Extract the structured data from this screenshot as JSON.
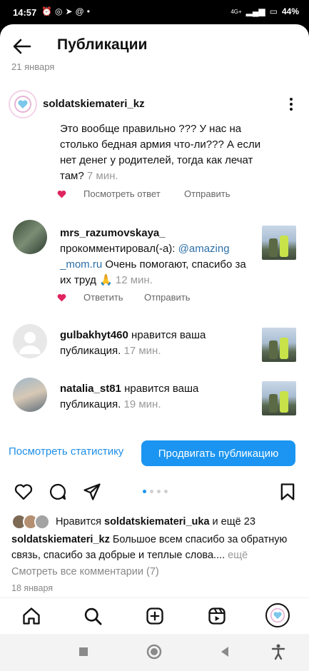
{
  "status": {
    "time": "14:57",
    "battery": "44%",
    "network": "4G+"
  },
  "header": {
    "title": "Публикации",
    "date_top": "21 января"
  },
  "comment1": {
    "username": "soldatskiemateri_kz",
    "text": "Это вообще правильно ??? У нас на столько бедная армия что-ли??? А если нет денег у родителей, тогда как лечат там?",
    "time": "7 мин.",
    "view_reply": "Посмотреть ответ",
    "send": "Отправить"
  },
  "comment2": {
    "username": "mrs_razumovskaya_",
    "verb": "прокомментировал(-а):",
    "mention_part1": "@amazing",
    "mention_part2": "_mom.ru",
    "text": "Очень помогают, спасибо за их труд 🙏",
    "time": "12 мин.",
    "reply": "Ответить",
    "send": "Отправить"
  },
  "like1": {
    "username": "gulbakhyt460",
    "text": "нравится ваша публикация.",
    "time": "17 мин."
  },
  "like2": {
    "username": "natalia_st81",
    "text": "нравится ваша публикация.",
    "time": "19 мин."
  },
  "actions": {
    "stats": "Посмотреть статистику",
    "promote": "Продвигать публикацию"
  },
  "post": {
    "likes_prefix": "Нравится",
    "likes_user": "soldatskiemateri_uka",
    "likes_suffix": "и ещё 23",
    "caption_user": "soldatskiemateri_kz",
    "caption_text": "Большое всем спасибо за обратную связь, спасибо за добрые и теплые слова....",
    "more": "ещё",
    "view_all": "Смотреть все комментарии (7)",
    "date": "18 января"
  },
  "colors": {
    "accent": "#1b95f1",
    "heart": "#e0245e",
    "link": "#2d6fa8"
  }
}
